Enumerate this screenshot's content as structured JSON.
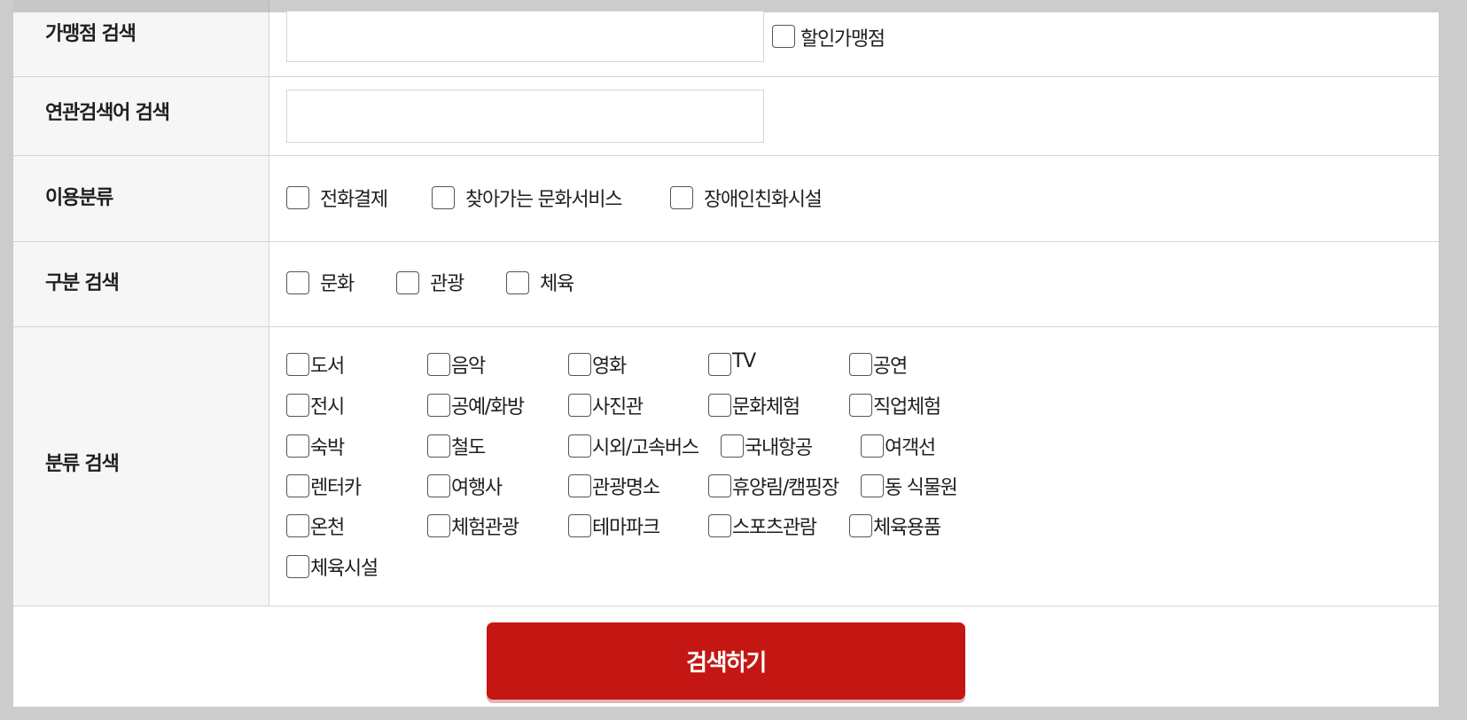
{
  "colors": {
    "accent": "#c41714",
    "label_bg": "#f6f6f6",
    "border": "#d4d4d4",
    "frame": "#cccccc"
  },
  "rows": {
    "store_search": {
      "label": "가맹점 검색",
      "input_value": "",
      "discount_checkbox_label": "할인가맹점"
    },
    "related_search": {
      "label": "연관검색어 검색",
      "input_value": ""
    },
    "usage_category": {
      "label": "이용분류",
      "options": [
        "전화결제",
        "찾아가는 문화서비스",
        "장애인친화시설"
      ]
    },
    "type_search": {
      "label": "구분 검색",
      "options": [
        "문화",
        "관광",
        "체육"
      ]
    },
    "category_search": {
      "label": "분류 검색",
      "options": [
        "도서",
        "음악",
        "영화",
        "TV",
        "공연",
        "전시",
        "공예/화방",
        "사진관",
        "문화체험",
        "직업체험",
        "숙박",
        "철도",
        "시외/고속버스",
        "국내항공",
        "여객선",
        "렌터카",
        "여행사",
        "관광명소",
        "휴양림/캠핑장",
        "동 식물원",
        "온천",
        "체험관광",
        "테마파크",
        "스포츠관람",
        "체육용품",
        "체육시설"
      ]
    }
  },
  "search_button": {
    "label": "검색하기"
  }
}
